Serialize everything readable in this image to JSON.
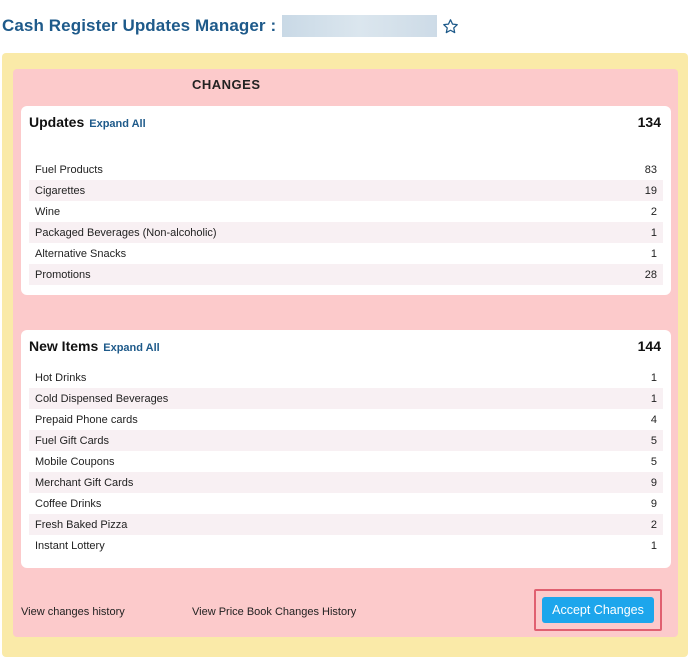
{
  "header": {
    "title": "Cash Register Updates Manager :"
  },
  "section_heading": "CHANGES",
  "updates": {
    "title": "Updates",
    "expand_label": "Expand All",
    "total": "134",
    "items": [
      {
        "label": "Fuel Products",
        "count": "83"
      },
      {
        "label": "Cigarettes",
        "count": "19"
      },
      {
        "label": "Wine",
        "count": "2"
      },
      {
        "label": "Packaged Beverages (Non-alcoholic)",
        "count": "1"
      },
      {
        "label": "Alternative Snacks",
        "count": "1"
      },
      {
        "label": "Promotions",
        "count": "28"
      }
    ]
  },
  "new_items": {
    "title": "New Items",
    "expand_label": "Expand All",
    "total": "144",
    "items": [
      {
        "label": "Hot Drinks",
        "count": "1"
      },
      {
        "label": "Cold Dispensed Beverages",
        "count": "1"
      },
      {
        "label": "Prepaid Phone cards",
        "count": "4"
      },
      {
        "label": "Fuel Gift Cards",
        "count": "5"
      },
      {
        "label": "Mobile Coupons",
        "count": "5"
      },
      {
        "label": "Merchant Gift Cards",
        "count": "9"
      },
      {
        "label": "Coffee Drinks",
        "count": "9"
      },
      {
        "label": "Fresh Baked Pizza",
        "count": "2"
      },
      {
        "label": "Instant Lottery",
        "count": "1"
      }
    ]
  },
  "footer": {
    "history_link": "View changes history",
    "pricebook_link": "View Price Book Changes History",
    "accept_button": "Accept Changes"
  },
  "colors": {
    "title_blue": "#1e5a8a",
    "outer_bg": "#faeaa8",
    "panel_bg": "#fccacb",
    "button_blue": "#1da6ec",
    "highlight_border": "#e06070"
  },
  "icons": {
    "favorite": "star-outline-icon"
  }
}
